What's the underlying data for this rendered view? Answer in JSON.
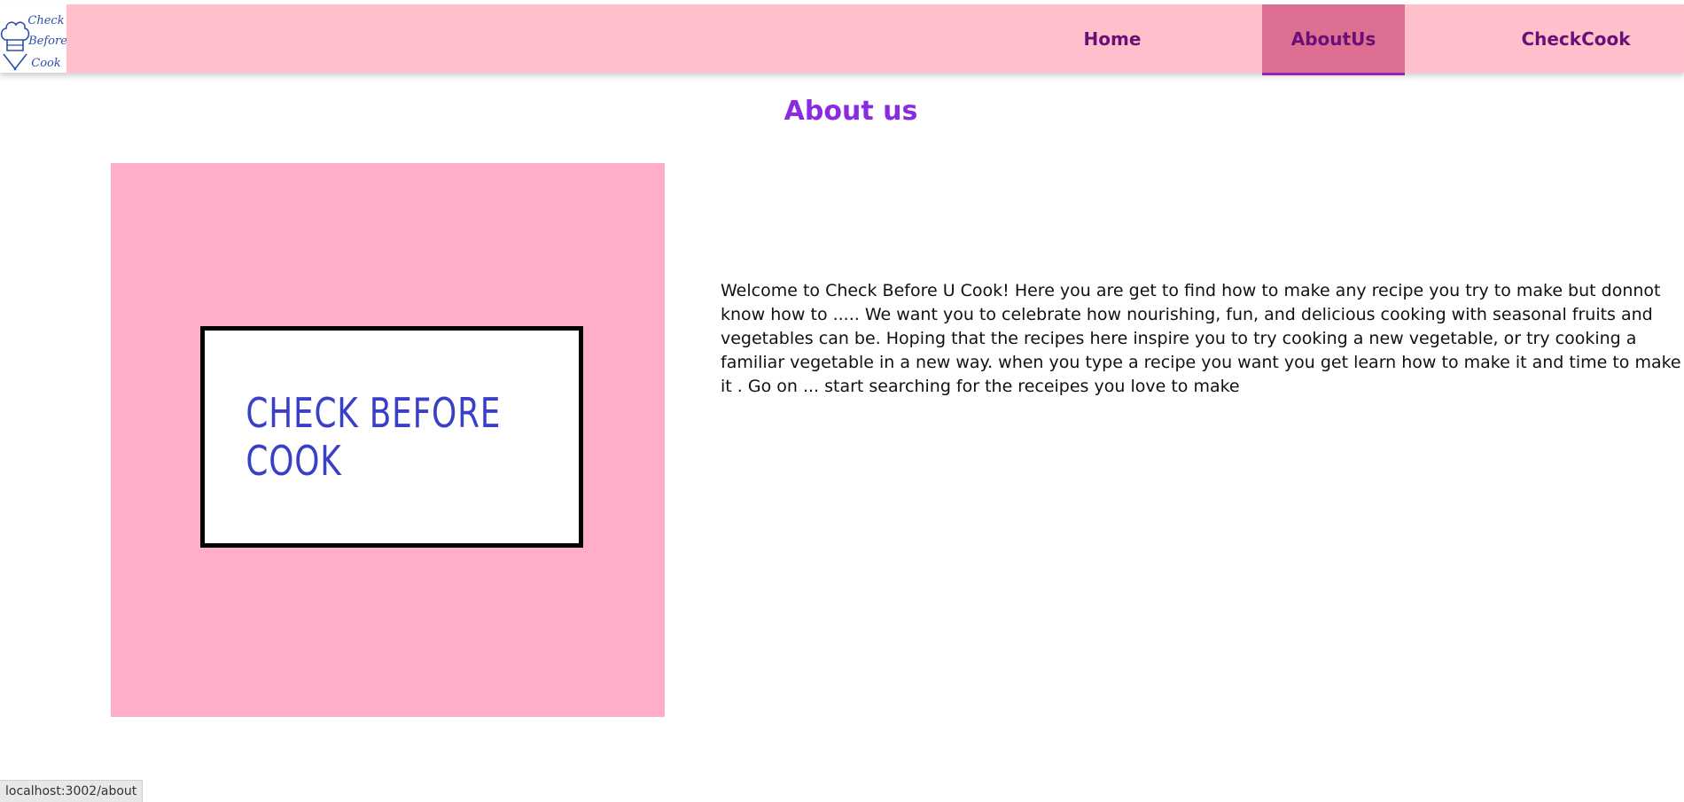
{
  "nav": {
    "logo_text_line1": "Check",
    "logo_text_line2": "Before",
    "logo_text_line3": "Cook",
    "links": [
      {
        "label": "Home"
      },
      {
        "label": "AboutUs"
      },
      {
        "label": "CheckCook"
      }
    ],
    "active_link": "AboutUs"
  },
  "page": {
    "title": "About us",
    "image_text": "CHECK BEFORE COOK",
    "description": "Welcome to Check Before U Cook! Here you are get to find how to make any recipe you try to make but donnot know how to ..... We want you to celebrate how nourishing, fun, and delicious cooking with seasonal fruits and vegetables can be. Hoping that the recipes here inspire you to try cooking a new vegetable, or try cooking a familiar vegetable in a new way. when you type a recipe you want you get learn how to make it and time to make it . Go on ... start searching for the receipes you love to make"
  },
  "status_bar": {
    "url": "localhost:3002/about"
  },
  "colors": {
    "navbar_bg": "#ffc0cb",
    "active_tab_bg": "#dc6f92",
    "nav_text": "#6b0f78",
    "heading": "#8a2be2",
    "image_box_bg": "#ffadc9",
    "logo_text": "#3a3fc7"
  },
  "icons": {
    "logo": "chef-hat-logo-icon"
  }
}
